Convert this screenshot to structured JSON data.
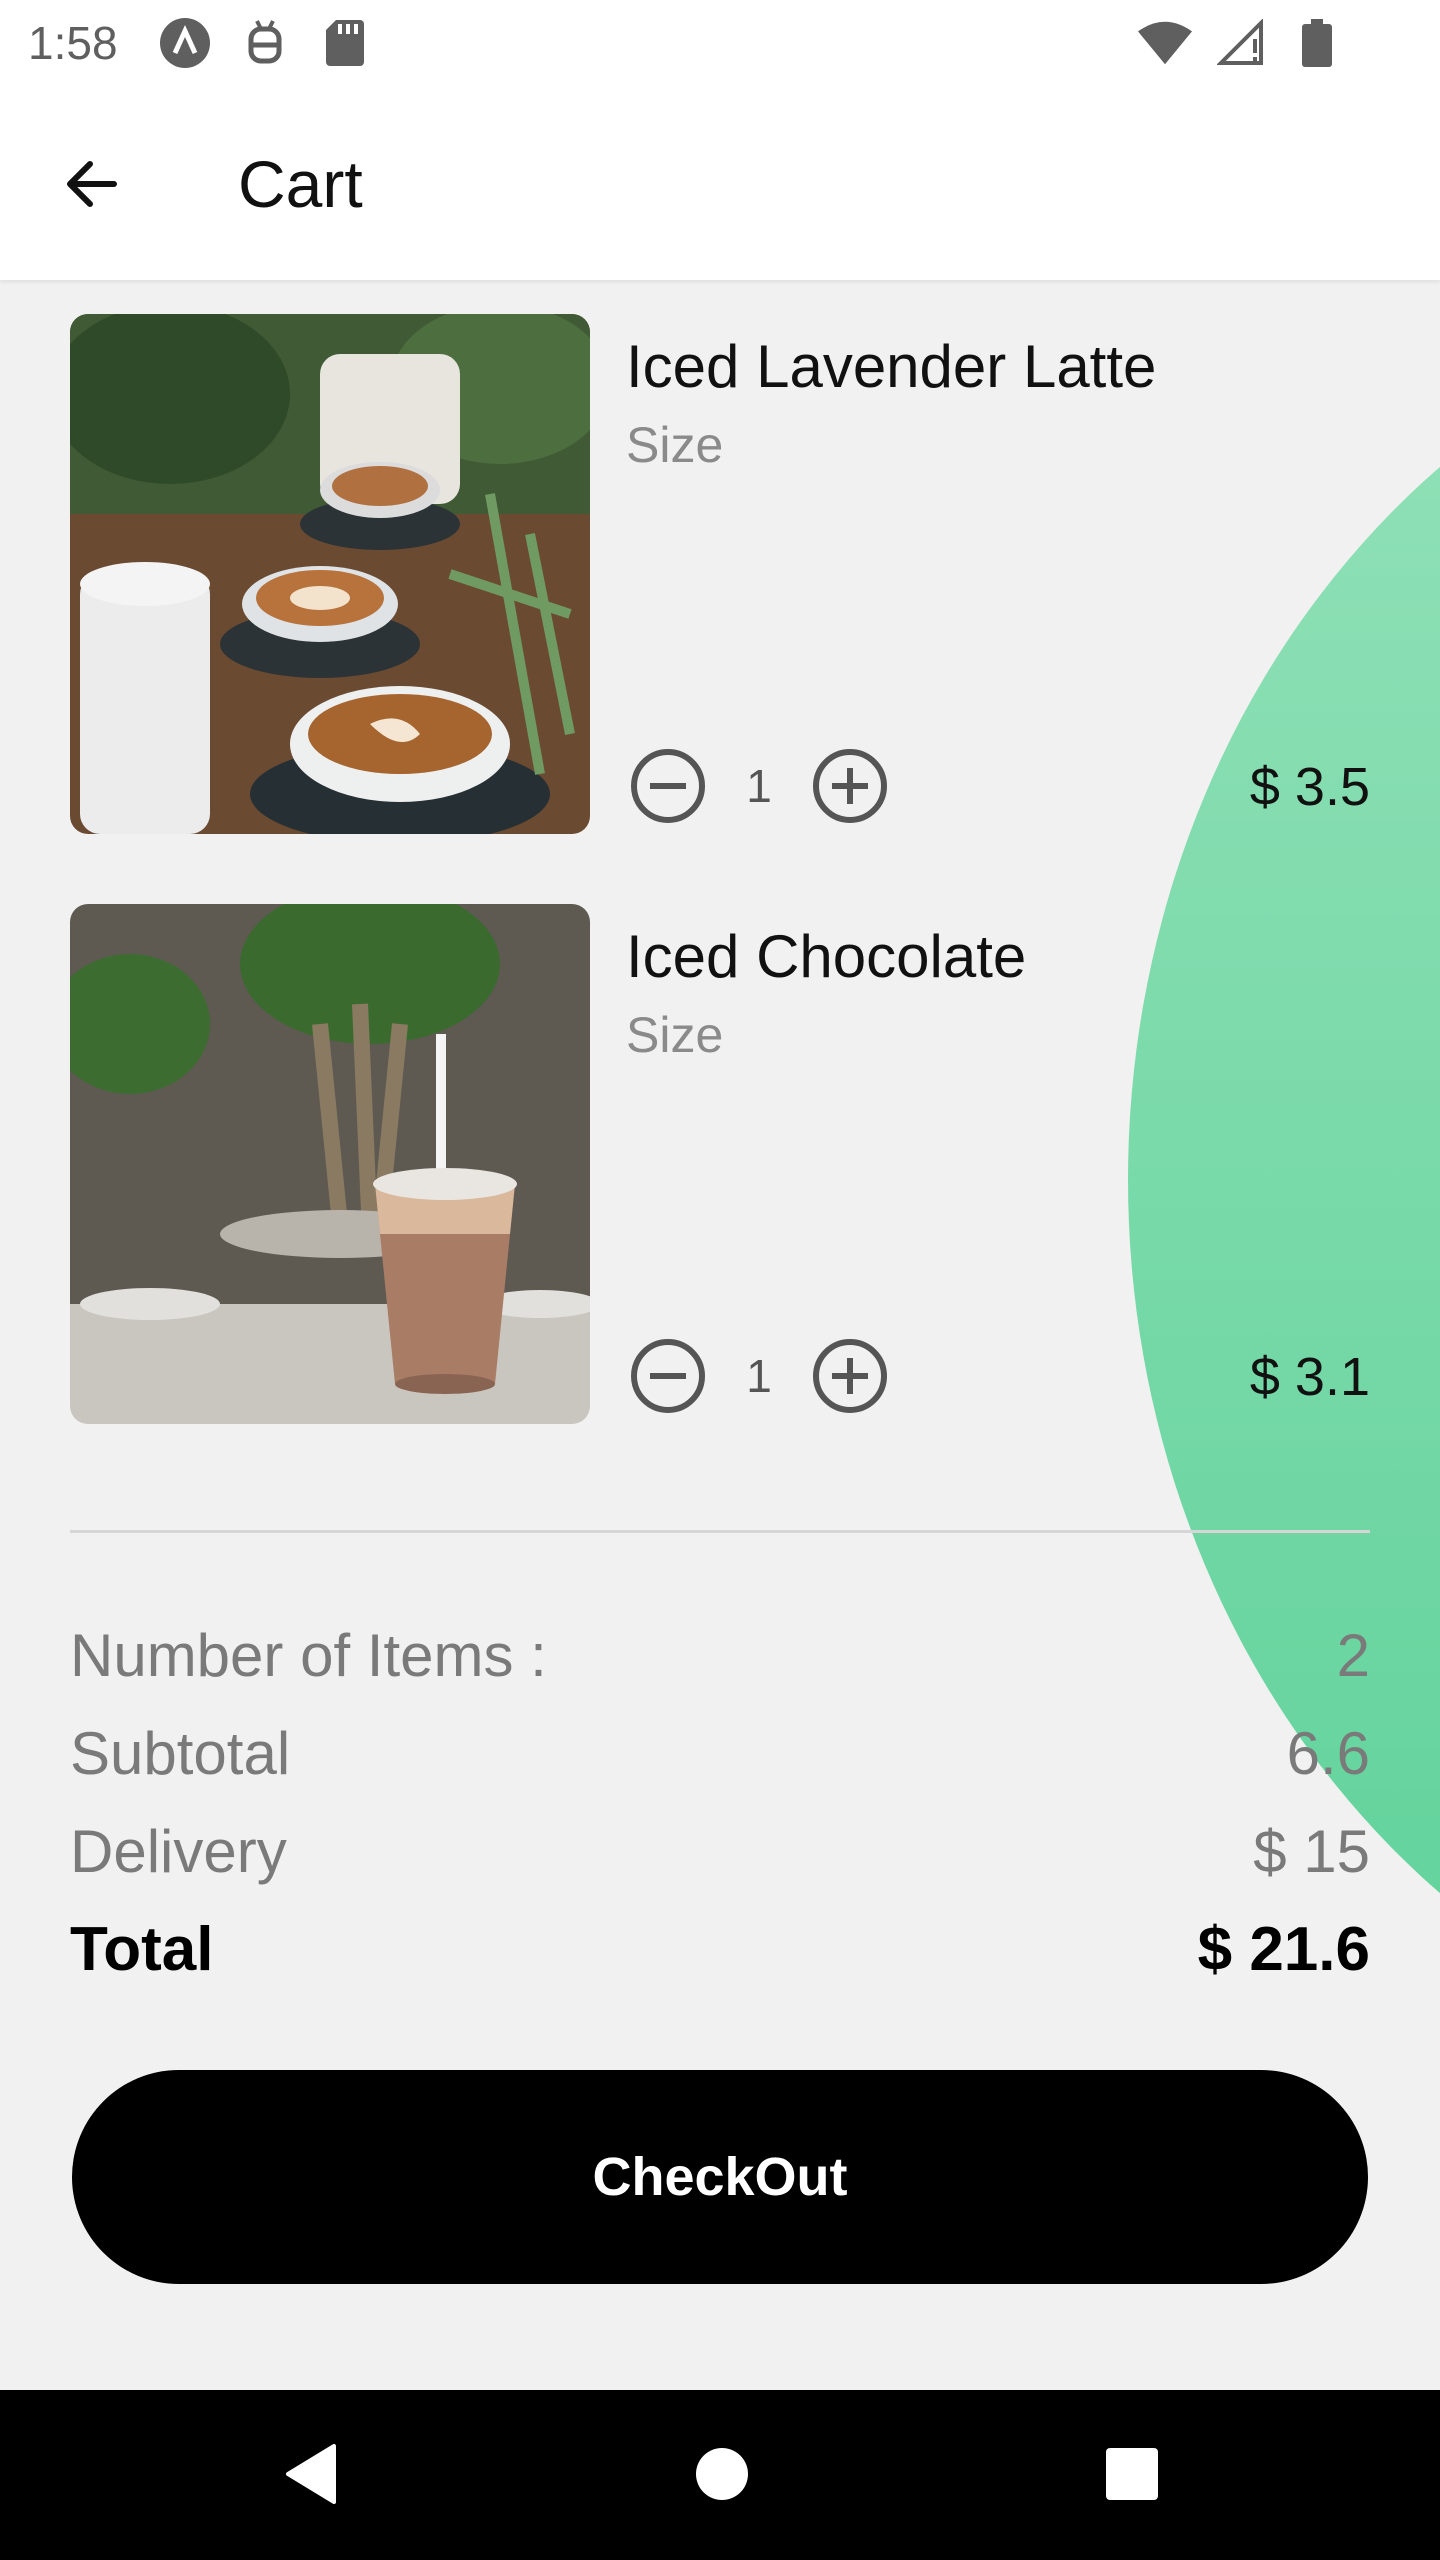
{
  "status_bar": {
    "time": "1:58",
    "left_icons": [
      "a-logo-icon",
      "bug-icon",
      "sd-card-icon"
    ],
    "right_icons": [
      "wifi-icon",
      "signal-icon",
      "battery-icon"
    ]
  },
  "app_bar": {
    "title": "Cart",
    "back_icon": "arrow-back-icon"
  },
  "cart": {
    "items": [
      {
        "name": "Iced Lavender Latte",
        "size_label": "Size",
        "quantity": "1",
        "price": "$ 3.5",
        "image": "latte-cups-photo"
      },
      {
        "name": "Iced Chocolate",
        "size_label": "Size",
        "quantity": "1",
        "price": "$ 3.1",
        "image": "iced-chocolate-photo"
      }
    ]
  },
  "summary": {
    "items_label": "Number of Items :",
    "items_value": "2",
    "subtotal_label": "Subtotal",
    "subtotal_value": "6.6",
    "delivery_label": "Delivery",
    "delivery_value": "$ 15",
    "total_label": "Total",
    "total_value": "$ 21.6"
  },
  "checkout": {
    "label": "CheckOut"
  },
  "colors": {
    "accent_green_top": "#93e1b8",
    "accent_green_bottom": "#5fd29a",
    "button_bg": "#000000",
    "background": "#f1f1f1"
  }
}
